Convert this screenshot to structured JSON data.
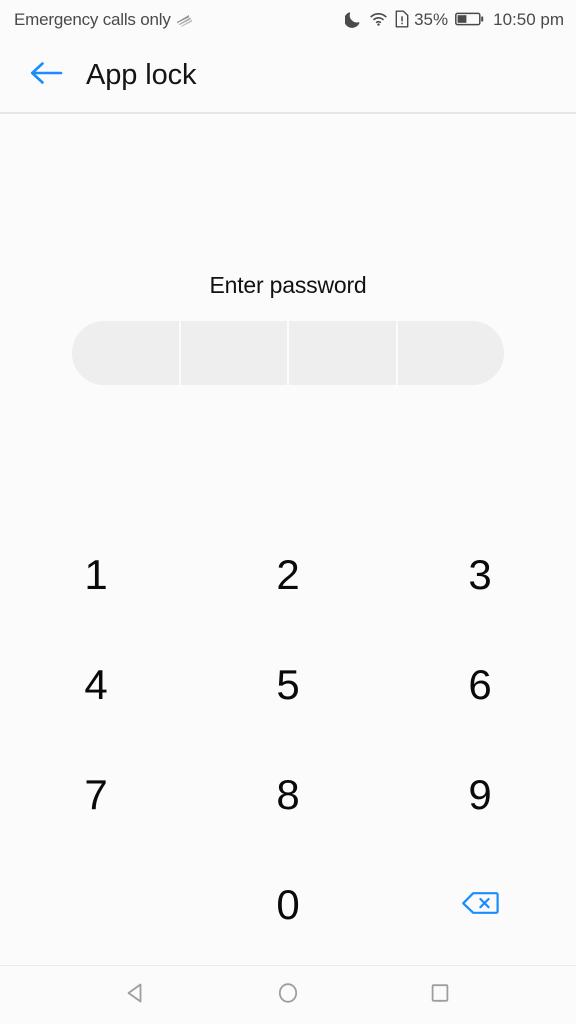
{
  "status_bar": {
    "carrier": "Emergency calls only",
    "signal_icon": "signal-bars-icon",
    "dnd_icon": "moon-do-not-disturb-icon",
    "wifi_icon": "wifi-icon",
    "sim_icon": "sim-card-alert-icon",
    "battery_percent": "35%",
    "battery_icon": "battery-icon",
    "battery_level": 40,
    "time": "10:50 pm"
  },
  "app_bar": {
    "back_icon": "back-arrow-icon",
    "title": "App lock",
    "accent_color": "#1a8cff"
  },
  "content": {
    "prompt": "Enter password",
    "password_field": {
      "cells": [
        "",
        "",
        "",
        ""
      ],
      "length": 4,
      "fill_color": "#eeeeee"
    }
  },
  "keypad": {
    "keys": [
      {
        "label": "1",
        "name": "key-1",
        "type": "digit"
      },
      {
        "label": "2",
        "name": "key-2",
        "type": "digit"
      },
      {
        "label": "3",
        "name": "key-3",
        "type": "digit"
      },
      {
        "label": "4",
        "name": "key-4",
        "type": "digit"
      },
      {
        "label": "5",
        "name": "key-5",
        "type": "digit"
      },
      {
        "label": "6",
        "name": "key-6",
        "type": "digit"
      },
      {
        "label": "7",
        "name": "key-7",
        "type": "digit"
      },
      {
        "label": "8",
        "name": "key-8",
        "type": "digit"
      },
      {
        "label": "9",
        "name": "key-9",
        "type": "digit"
      },
      {
        "label": "",
        "name": "key-blank",
        "type": "blank"
      },
      {
        "label": "0",
        "name": "key-0",
        "type": "digit"
      },
      {
        "label": "",
        "name": "key-backspace",
        "type": "backspace"
      }
    ],
    "backspace_icon": "backspace-delete-icon",
    "backspace_color": "#1a8cff"
  },
  "nav_bar": {
    "back_icon": "nav-back-triangle-icon",
    "home_icon": "nav-home-circle-icon",
    "recents_icon": "nav-recents-square-icon",
    "icon_color": "#9e9e9e"
  }
}
